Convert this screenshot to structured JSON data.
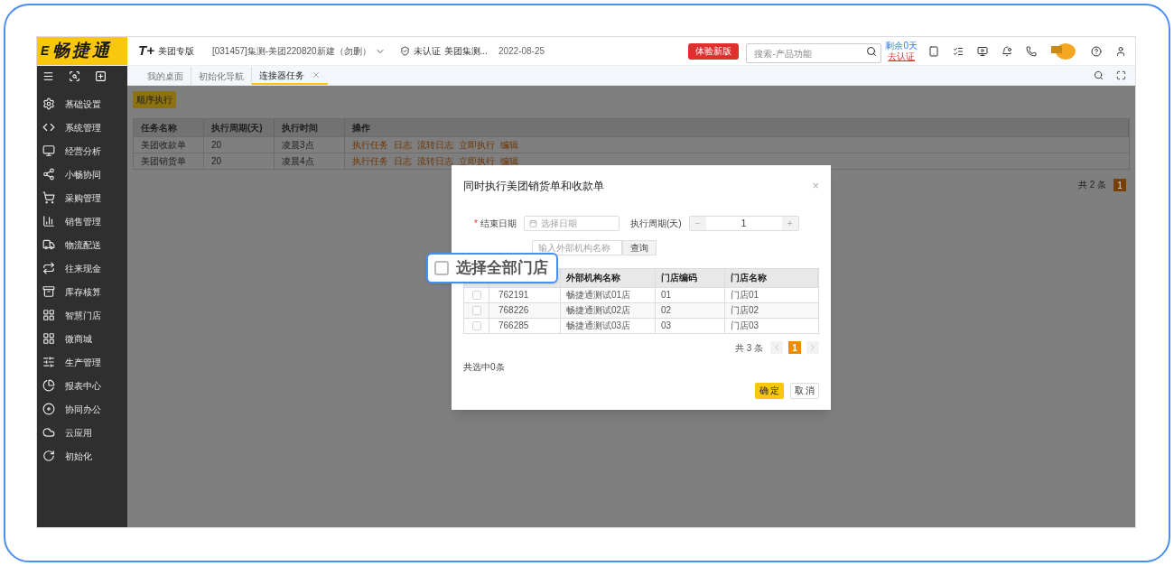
{
  "header": {
    "logo_mark": "E",
    "logo": "畅捷通",
    "brand_mark": "T+",
    "brand": "美团专版",
    "company": "[031457]集测-美团220820新建（勿删）",
    "cert": "未认证",
    "cert_org": "美团集测...",
    "date": "2022-08-25",
    "trial_button": "体验新版",
    "search": {
      "placeholder": "搜索-产品功能"
    },
    "days_left": "剩余0天",
    "certify_link": "去认证"
  },
  "tabs": [
    {
      "label": "我的桌面",
      "selected": false
    },
    {
      "label": "初始化导航",
      "selected": false
    },
    {
      "label": "连接器任务",
      "selected": true
    }
  ],
  "sidebar": {
    "items": [
      "基础设置",
      "系统管理",
      "经营分析",
      "小畅协同",
      "采购管理",
      "销售管理",
      "物流配送",
      "往来现金",
      "库存核算",
      "智慧门店",
      "微商城",
      "生产管理",
      "报表中心",
      "协同办公",
      "云应用",
      "初始化"
    ]
  },
  "content": {
    "sequence_button": "顺序执行",
    "table": {
      "columns": [
        "任务名称",
        "执行周期(天)",
        "执行时间",
        "操作"
      ],
      "rows": [
        {
          "name": "美团收款单",
          "cycle": "20",
          "time": "凌晨3点",
          "actions": [
            "执行任务",
            "日志",
            "流转日志",
            "立即执行",
            "编辑"
          ]
        },
        {
          "name": "美团销货单",
          "cycle": "20",
          "time": "凌晨4点",
          "actions": [
            "执行任务",
            "日志",
            "流转日志",
            "立即执行",
            "编辑"
          ]
        }
      ]
    },
    "pagination": {
      "total": "共 2 条",
      "pages": [
        {
          "label": "1",
          "selected": true
        }
      ]
    }
  },
  "dialog": {
    "title": "同时执行美团销货单和收款单",
    "close": "×",
    "end_date": {
      "label": "结束日期",
      "required_mark": "*",
      "placeholder": "选择日期"
    },
    "cycle": {
      "label": "执行周期(天)",
      "minus": "−",
      "value": "1",
      "plus": "+"
    },
    "store_search": {
      "placeholder": "输入外部机构名称",
      "button": "查询"
    },
    "table": {
      "columns": [
        "外部机构名称",
        "门店编码",
        "门店名称"
      ],
      "rows": [
        {
          "checked": false,
          "id": "762191",
          "name": "畅捷通测试01店",
          "code": "01",
          "store": "门店01"
        },
        {
          "checked": false,
          "id": "768226",
          "name": "畅捷通测试02店",
          "code": "02",
          "store": "门店02"
        },
        {
          "checked": false,
          "id": "766285",
          "name": "畅捷通测试03店",
          "code": "03",
          "store": "门店03"
        }
      ]
    },
    "pagination": {
      "total": "共 3 条",
      "pages": [
        {
          "label": "1",
          "selected": true
        }
      ]
    },
    "selected_count": "共选中0条",
    "ok_button": "确 定",
    "cancel_button": "取 消"
  },
  "callout": {
    "label": "选择全部门店",
    "checked": false
  }
}
